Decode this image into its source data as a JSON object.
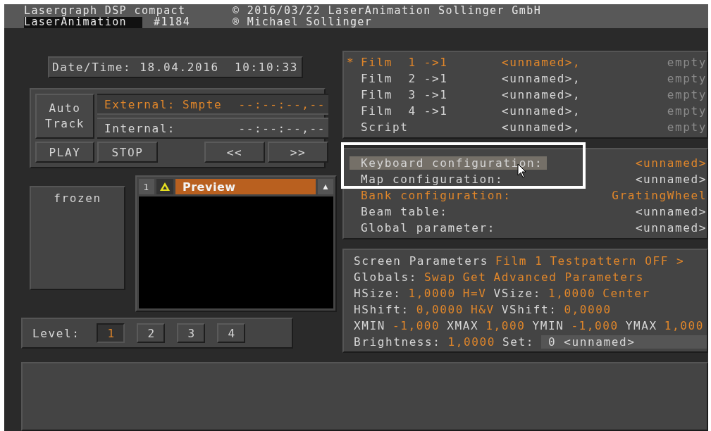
{
  "header": {
    "product": "Lasergraph DSP compact",
    "owner": "LaserAnimation",
    "serial": "#1184",
    "copyright": "© 2016/03/22 LaserAnimation Sollinger GmbH",
    "author": "® Michael Sollinger"
  },
  "date_time": {
    "label": "Date/Time:",
    "value": "18.04.2016  10:10:33"
  },
  "transport": {
    "auto_track": "Auto Track",
    "external": {
      "label": "External:",
      "source": "Smpte",
      "time": "--:--:--,--",
      "active": true
    },
    "internal": {
      "label": "Internal:",
      "time": "--:--:--,--",
      "active": false
    },
    "buttons": [
      "PLAY",
      "STOP",
      "<<",
      ">>"
    ]
  },
  "frozen": "frozen",
  "preview": {
    "number": "1",
    "title": "Preview",
    "arrow": "▲"
  },
  "level": {
    "label": "Level:",
    "tabs": [
      {
        "label": "1",
        "selected": true
      },
      {
        "label": "2",
        "selected": false
      },
      {
        "label": "3",
        "selected": false
      },
      {
        "label": "4",
        "selected": false
      }
    ]
  },
  "films": {
    "marker": "*",
    "rows": [
      {
        "name": "Film  1 ->1",
        "show": "<unnamed>,",
        "status": "empty",
        "selected": true
      },
      {
        "name": "Film  2 ->1",
        "show": "<unnamed>,",
        "status": "empty",
        "selected": false
      },
      {
        "name": "Film  3 ->1",
        "show": "<unnamed>,",
        "status": "empty",
        "selected": false
      },
      {
        "name": "Film  4 ->1",
        "show": "<unnamed>,",
        "status": "empty",
        "selected": false
      },
      {
        "name": "Script",
        "show": "<unnamed>,",
        "status": "empty",
        "selected": false
      }
    ]
  },
  "configs": [
    {
      "label": "Keyboard configuration:",
      "value": "<unnamed>",
      "selected": true,
      "emphasized": false,
      "value_emphasized": true
    },
    {
      "label": "Map configuration:",
      "value": "<unnamed>",
      "selected": false,
      "emphasized": false,
      "value_emphasized": false
    },
    {
      "label": "Bank configuration:",
      "value": "GratingWheel",
      "selected": false,
      "emphasized": true,
      "value_emphasized": true
    },
    {
      "label": "Beam table:",
      "value": "<unnamed>",
      "selected": false,
      "emphasized": false,
      "value_emphasized": false
    },
    {
      "label": "Global parameter:",
      "value": "<unnamed>",
      "selected": false,
      "emphasized": false,
      "value_emphasized": false
    }
  ],
  "screen_parameters": [
    [
      {
        "text": "Screen Parameters",
        "kind": "label"
      },
      {
        "text": "Film 1",
        "kind": "value"
      },
      {
        "text": "Testpattern OFF >",
        "kind": "value"
      }
    ],
    [
      {
        "text": "Globals:",
        "kind": "label"
      },
      {
        "text": "Swap",
        "kind": "value"
      },
      {
        "text": "Get",
        "kind": "value"
      },
      {
        "text": "Advanced Parameters",
        "kind": "value"
      }
    ],
    [
      {
        "text": "HSize:",
        "kind": "label"
      },
      {
        "text": "1,0000",
        "kind": "value"
      },
      {
        "text": "H=V",
        "kind": "value"
      },
      {
        "text": "VSize:",
        "kind": "label"
      },
      {
        "text": "1,0000",
        "kind": "value"
      },
      {
        "text": "Center",
        "kind": "value"
      }
    ],
    [
      {
        "text": "HShift:",
        "kind": "label"
      },
      {
        "text": "0,0000",
        "kind": "value"
      },
      {
        "text": "H&V",
        "kind": "value"
      },
      {
        "text": "VShift:",
        "kind": "label"
      },
      {
        "text": "0,0000",
        "kind": "value"
      }
    ],
    [
      {
        "text": "XMIN",
        "kind": "label"
      },
      {
        "text": "-1,000",
        "kind": "value"
      },
      {
        "text": "XMAX",
        "kind": "label"
      },
      {
        "text": "1,000",
        "kind": "value"
      },
      {
        "text": "YMIN",
        "kind": "label"
      },
      {
        "text": "-1,000",
        "kind": "value"
      },
      {
        "text": "YMAX",
        "kind": "label"
      },
      {
        "text": "1,000",
        "kind": "value"
      }
    ],
    [
      {
        "text": "Brightness:",
        "kind": "label"
      },
      {
        "text": "1,0000",
        "kind": "value"
      },
      {
        "text": "Set:",
        "kind": "label"
      },
      {
        "text": "0 <unnamed>",
        "kind": "field"
      }
    ]
  ]
}
